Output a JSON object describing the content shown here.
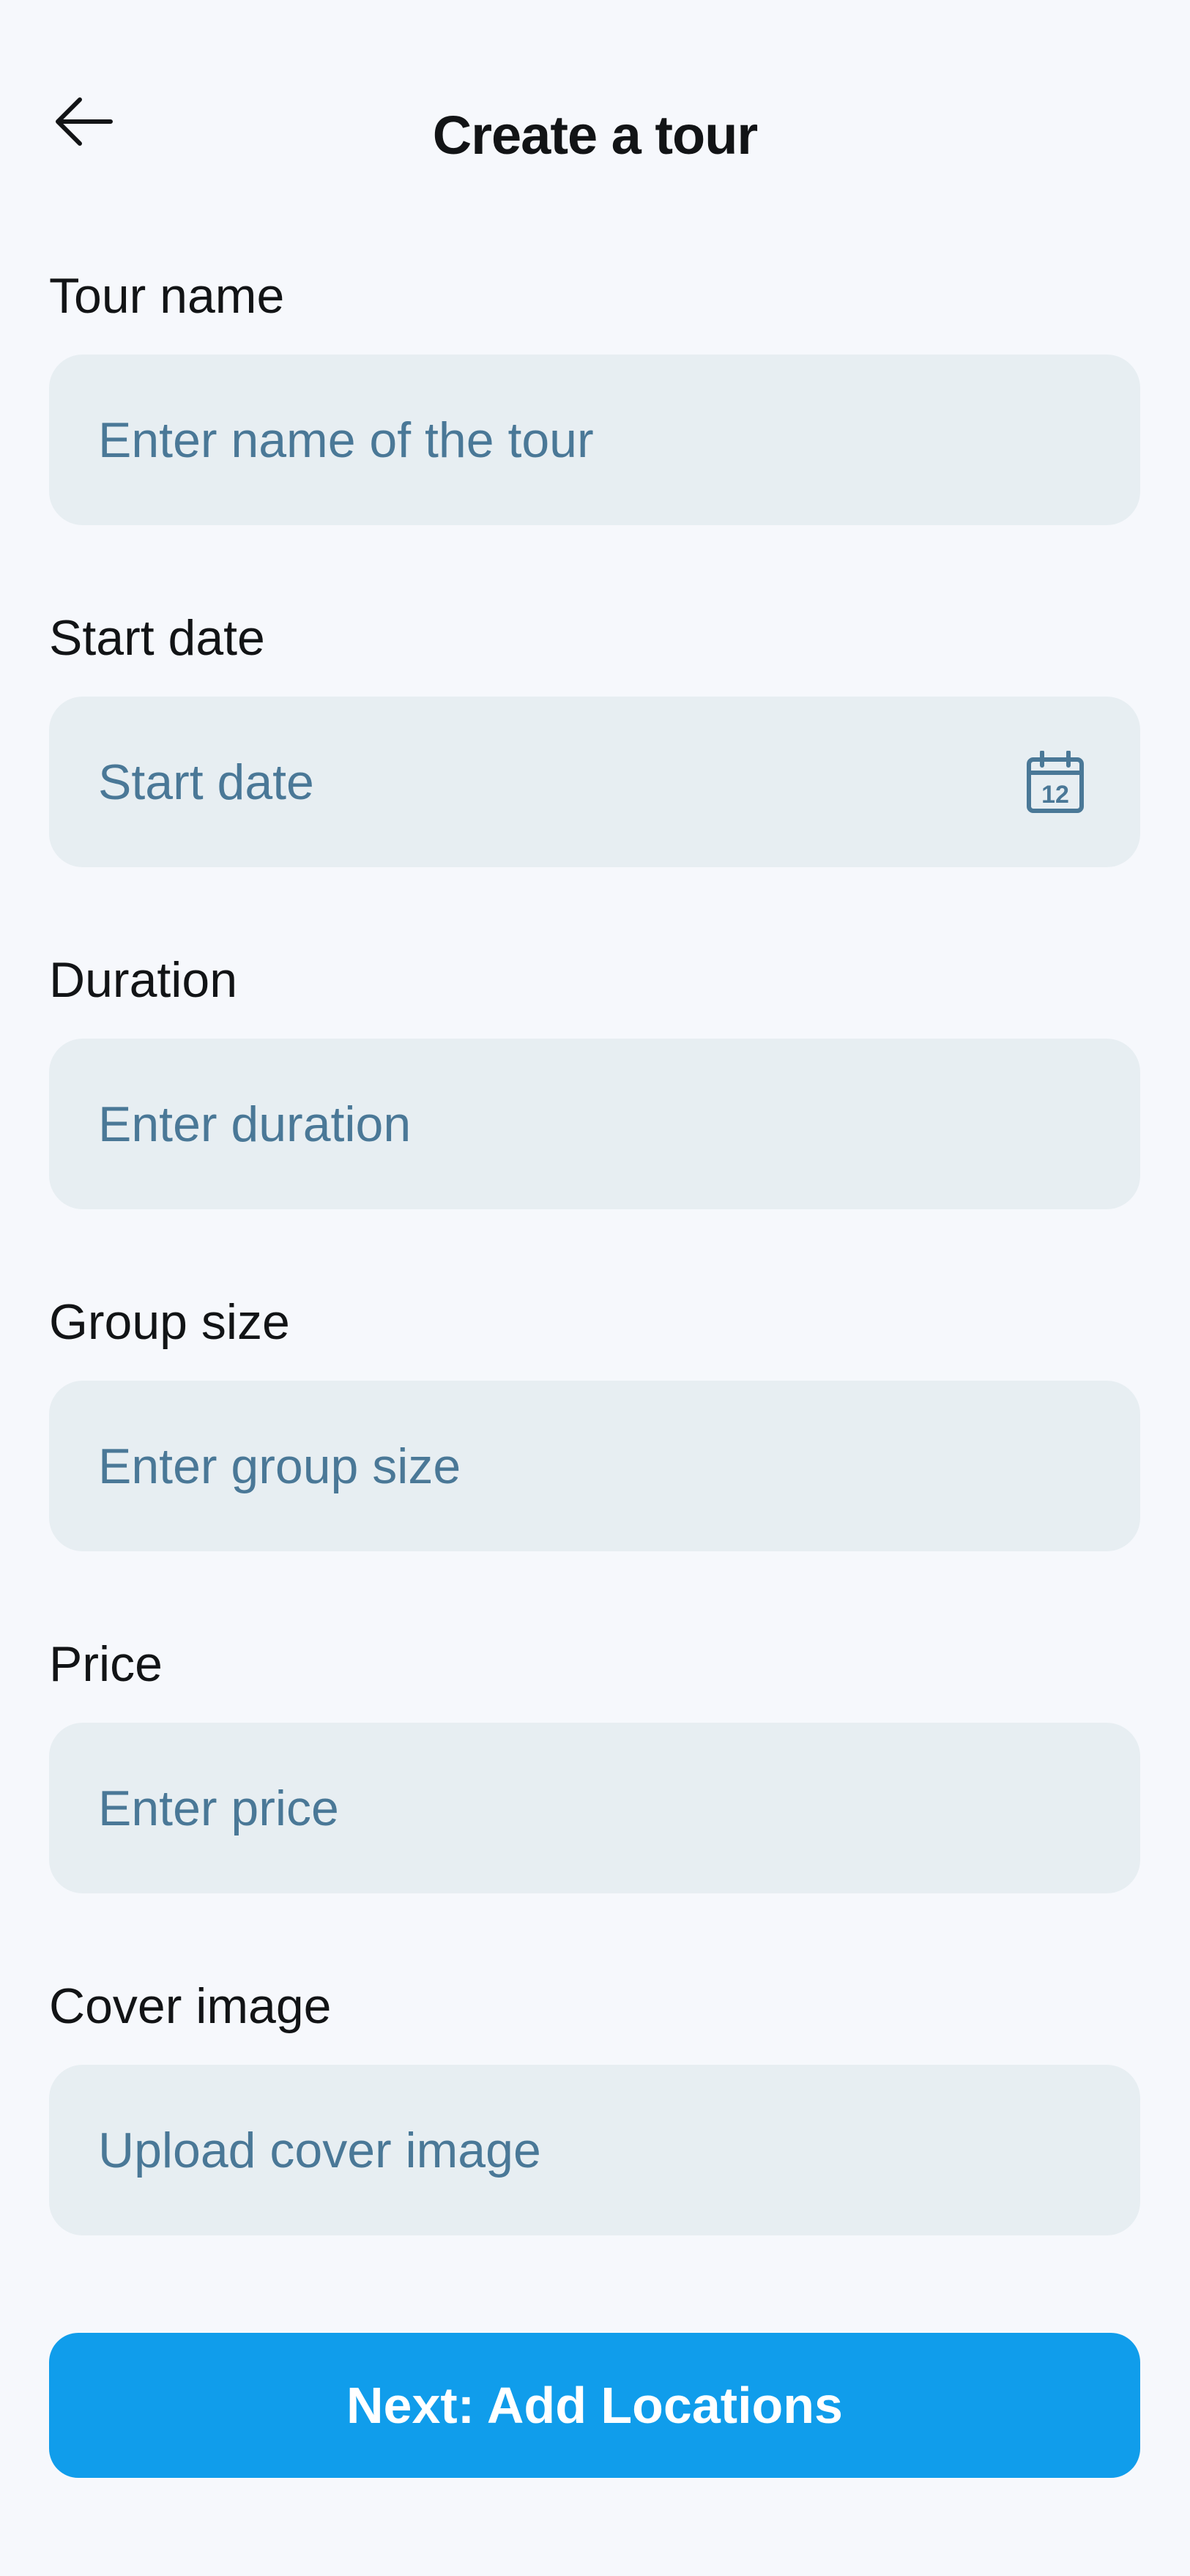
{
  "header": {
    "title": "Create a tour",
    "back_icon": "arrow-left-icon"
  },
  "form": {
    "tour_name": {
      "label": "Tour name",
      "placeholder": "Enter name of the tour",
      "value": ""
    },
    "start_date": {
      "label": "Start date",
      "placeholder": "Start date",
      "value": "",
      "icon": "calendar-icon",
      "icon_text": "12"
    },
    "duration": {
      "label": "Duration",
      "placeholder": "Enter duration",
      "value": ""
    },
    "group_size": {
      "label": "Group size",
      "placeholder": "Enter group size",
      "value": ""
    },
    "price": {
      "label": "Price",
      "placeholder": "Enter price",
      "value": ""
    },
    "cover_image": {
      "label": "Cover image",
      "placeholder": "Upload cover image",
      "value": ""
    }
  },
  "actions": {
    "next_label": "Next: Add Locations"
  },
  "colors": {
    "background": "#f6f8fc",
    "input_background": "#e7eef2",
    "placeholder_text": "#4a7897",
    "primary_button": "#109deb",
    "text": "#121416"
  }
}
